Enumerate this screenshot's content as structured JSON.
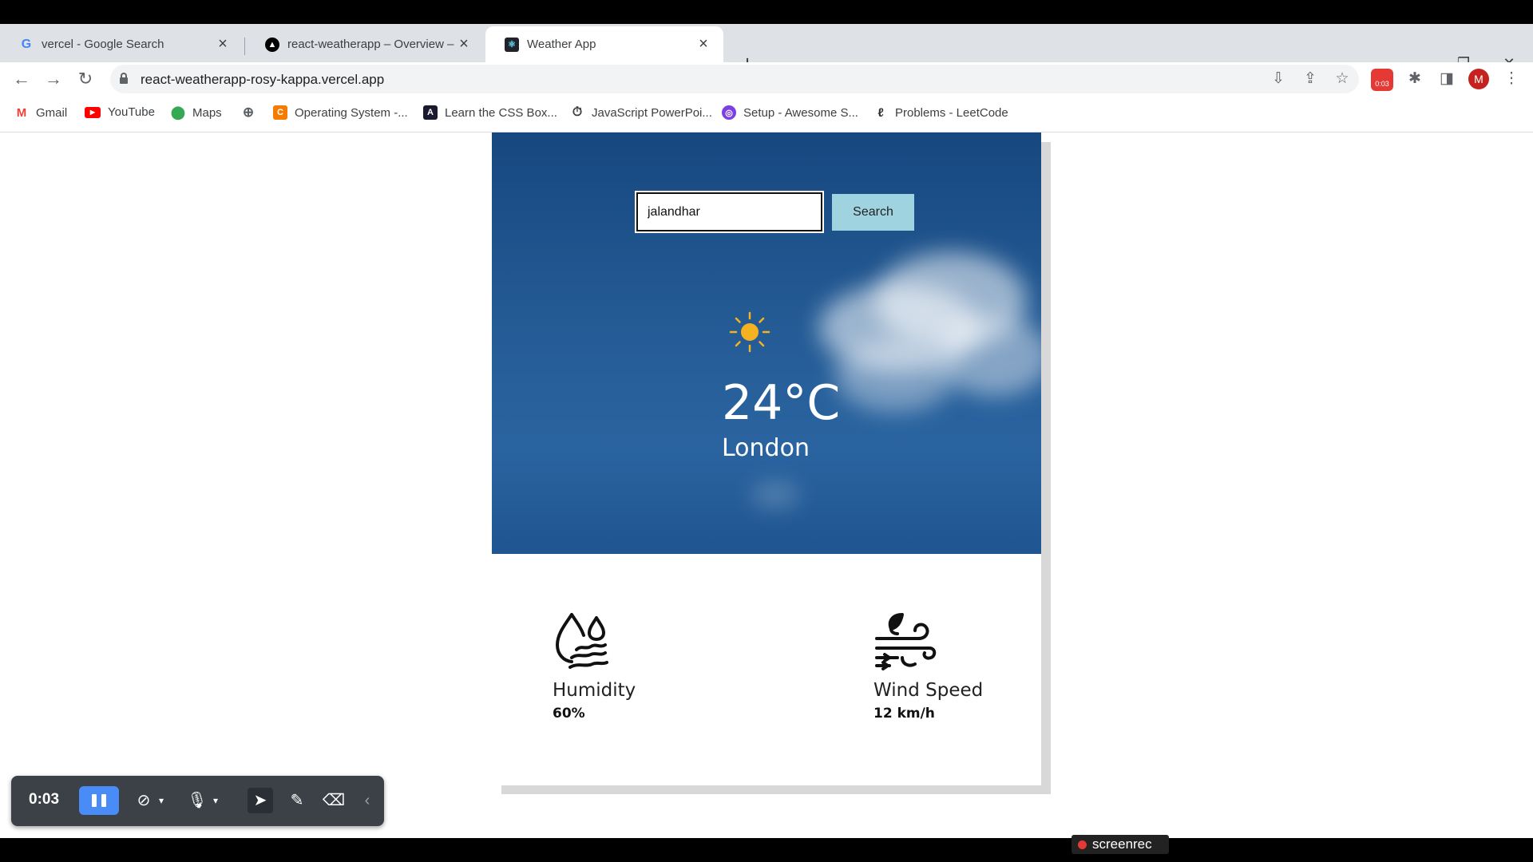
{
  "browser": {
    "tabs": [
      {
        "title": "vercel - Google Search",
        "favicon": "google-icon",
        "active": false
      },
      {
        "title": "react-weatherapp – Overview – V",
        "favicon": "vercel-icon",
        "active": false
      },
      {
        "title": "Weather App",
        "favicon": "react-icon",
        "active": true
      }
    ],
    "new_tab": "+",
    "address": "react-weatherapp-rosy-kappa.vercel.app",
    "profile_initial": "M",
    "record_extension_badge": "0:03",
    "bookmarks": [
      {
        "label": "Gmail",
        "icon": "gmail-icon"
      },
      {
        "label": "YouTube",
        "icon": "youtube-icon"
      },
      {
        "label": "Maps",
        "icon": "maps-icon"
      },
      {
        "label": "",
        "icon": "globe-icon"
      },
      {
        "label": "Operating System -...",
        "icon": "course-icon"
      },
      {
        "label": "Learn the CSS Box...",
        "icon": "css-icon"
      },
      {
        "label": "JavaScript PowerPoi...",
        "icon": "timer-icon"
      },
      {
        "label": "Setup - Awesome S...",
        "icon": "setup-icon"
      },
      {
        "label": "Problems - LeetCode",
        "icon": "leetcode-icon"
      }
    ]
  },
  "weather": {
    "search_value": "jalandhar",
    "search_button": "Search",
    "icon": "sun-icon",
    "temperature": "24°C",
    "city": "London",
    "humidity_label": "Humidity",
    "humidity_value": "60%",
    "wind_label": "Wind Speed",
    "wind_value": "12 km/h"
  },
  "recorder": {
    "elapsed": "0:03",
    "brand": "screenrec"
  },
  "colors": {
    "sky": "#245b95",
    "search_button": "#9fd3e0",
    "sun": "#f5b220",
    "accent": "#4a8cf7"
  }
}
